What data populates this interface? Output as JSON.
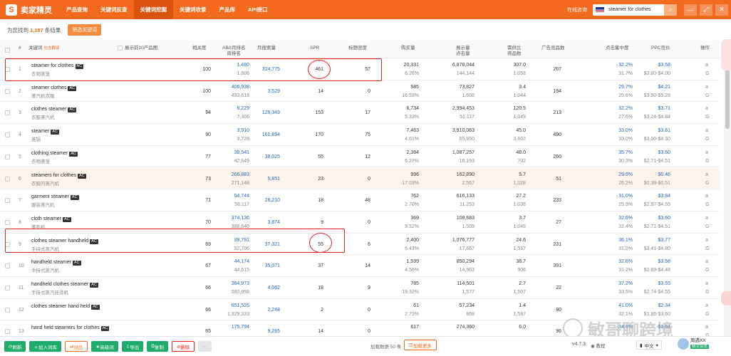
{
  "app": {
    "name": "卖家精灵",
    "logo_char": "S"
  },
  "nav": [
    "产品查询",
    "关键词反查",
    "关键词挖掘",
    "关键词收录",
    "产品库",
    "API接口"
  ],
  "nav_active": 2,
  "top": {
    "online": "在线咨询",
    "search_value": "steamer for clothes",
    "search_icon": "search-icon",
    "min": "—",
    "max": "⤢",
    "close": "✕"
  },
  "summary": {
    "prefix": "为您找到",
    "count": "1,187",
    "suffix": "条结果",
    "filter_btn": "筛选关键词"
  },
  "headers": {
    "keyword": "关键词",
    "keyword_sub": "包含翻译",
    "show_top10": "展示前10产品图",
    "relevance": "相关度",
    "aba_line1": "ABA月排名",
    "aba_line2": "周排名",
    "monthly_search": "月搜索量",
    "spr": "SPR",
    "title_density": "标题密度",
    "purchases": "购买量",
    "imp_line1": "展示量",
    "imp_line2": "点击量",
    "supply_line1": "需供比",
    "supply_line2": "商品数",
    "ad_count": "广告竞品数",
    "click_conc": "点击集中度",
    "ppc": "PPC竞价",
    "ops": "操作"
  },
  "rows": [
    {
      "idx": "1",
      "kw": "steamer for clothes",
      "cn": "衣物蒸笼",
      "rel": "100",
      "aba": "1,480",
      "aba_w": "1,806",
      "ms": "324,775",
      "spr": "461",
      "td": "57",
      "buy": "20,331",
      "buy_p": "6.26%",
      "imp": "6,878,044",
      "clk": "144,144",
      "sr": "307.0",
      "goods": "1,058",
      "ad": "267",
      "cc": "32.2%",
      "cc2": "31.7%",
      "ppc": "$3.58",
      "ppc_r": "$3.00-$4.00"
    },
    {
      "idx": "2",
      "kw": "steamer clothes",
      "cn": "蒸汽机衣服",
      "rel": "100",
      "aba": "406,938",
      "aba_w": "493,618",
      "ms": "3,529",
      "spr": "14",
      "td": "0",
      "buy": "585",
      "buy_p": "16.59%",
      "imp": "73,827",
      "clk": "1,666",
      "sr": "3.4",
      "goods": "1,044",
      "ad": "194",
      "cc": "29.7%",
      "cc2": "25.6%",
      "ppc": "$4.21",
      "ppc_r": "$3.50-$5.28"
    },
    {
      "idx": "3",
      "kw": "clothes steamer",
      "cn": "衣服蒸汽机",
      "rel": "94",
      "aba": "6,229",
      "aba_w": "7,306",
      "ms": "126,349",
      "spr": "153",
      "td": "17",
      "buy": "6,734",
      "buy_p": "5.33%",
      "imp": "2,994,453",
      "clk": "51,117",
      "sr": "120.5",
      "goods": "1,049",
      "ad": "213",
      "cc": "32.2%",
      "cc2": "27.6%",
      "ppc": "$3.71",
      "ppc_r": "$3.24-$4.84"
    },
    {
      "idx": "4",
      "kw": "steamer",
      "cn": "蒸锅",
      "rel": "90",
      "aba": "3,910",
      "aba_w": "3,728",
      "ms": "161,894",
      "spr": "170",
      "td": "75",
      "buy": "7,463",
      "buy_p": "4.61%",
      "imp": "3,910,063",
      "clk": "65,950",
      "sr": "45.0",
      "goods": "3,602",
      "ad": "490",
      "cc": "33.0%",
      "cc2": "33.0%",
      "ppc": "$3.61",
      "ppc_r": "$3.00-$4.30"
    },
    {
      "idx": "5",
      "kw": "clothing steamer",
      "cn": "衣物蒸笼",
      "rel": "77",
      "aba": "38,541",
      "aba_w": "42,649",
      "ms": "38,025",
      "spr": "55",
      "td": "12",
      "buy": "2,384",
      "buy_p": "6.27%",
      "imp": "1,087,257",
      "clk": "16,193",
      "sr": "48.0",
      "goods": "792",
      "ad": "260",
      "cc": "35.7%",
      "cc2": "30.3%",
      "ppc": "$3.60",
      "ppc_r": "$2.71-$4.51"
    },
    {
      "idx": "6",
      "kw": "steamers for clothes",
      "cn": "衣服的蒸汽机",
      "rel": "73",
      "aba": "266,883",
      "aba_w": "271,148",
      "ms": "5,851",
      "spr": "23",
      "td": "0",
      "buy": "996",
      "buy_p": "17.03%",
      "imp": "162,890",
      "clk": "2,567",
      "sr": "5.7",
      "goods": "1,028",
      "ad": "51",
      "cc": "29.6%",
      "cc2": "26.2%",
      "ppc": "$0.46",
      "ppc_r": "$0.38-$0.51"
    },
    {
      "idx": "7",
      "kw": "garment steamer",
      "cn": "服装蒸汽机",
      "rel": "71",
      "aba": "54,744",
      "aba_w": "58,117",
      "ms": "28,210",
      "spr": "18",
      "td": "48",
      "buy": "762",
      "buy_p": "2.70%",
      "imp": "616,133",
      "clk": "11,253",
      "sr": "27.2",
      "goods": "1,036",
      "ad": "233",
      "cc": "31.0%",
      "cc2": "25.9%",
      "ppc": "$3.84",
      "ppc_r": "$2.97-$4.55"
    },
    {
      "idx": "8",
      "kw": "cloth steamer",
      "cn": "蒸布机",
      "rel": "70",
      "aba": "374,136",
      "aba_w": "388,640",
      "ms": "3,874",
      "spr": "9",
      "td": "0",
      "buy": "369",
      "buy_p": "9.52%",
      "imp": "108,683",
      "clk": "1,509",
      "sr": "3.7",
      "goods": "1,045",
      "ad": "27",
      "cc": "32.6%",
      "cc2": "32.4%",
      "ppc": "$3.60",
      "ppc_r": "$2.71-$4.51"
    },
    {
      "idx": "9",
      "kw": "clothes steamer handheld",
      "cn": "手持式蒸汽机",
      "rel": "69",
      "aba": "39,791",
      "aba_w": "52,706",
      "ms": "37,321",
      "spr": "55",
      "td": "6",
      "buy": "2,400",
      "buy_p": "6.43%",
      "imp": "1,076,777",
      "clk": "17,667",
      "sr": "24.6",
      "goods": "1,517",
      "ad": "231",
      "cc": "36.1%",
      "cc2": "31.0%",
      "ppc": "$3.77",
      "ppc_r": "$3.41-$4.80"
    },
    {
      "idx": "10",
      "kw": "handheld steamer",
      "cn": "手持式蒸汽机",
      "rel": "67",
      "aba": "44,174",
      "aba_w": "44,615",
      "ms": "35,071",
      "spr": "37",
      "td": "14",
      "buy": "1,599",
      "buy_p": "4.56%",
      "imp": "850,294",
      "clk": "14,963",
      "sr": "38.7",
      "goods": "906",
      "ad": "391",
      "cc": "32.6%",
      "cc2": "31.2%",
      "ppc": "$3.58",
      "ppc_r": "$2.69-$4.48"
    },
    {
      "idx": "11",
      "kw": "handheld clothes steamer",
      "cn": "手持式蒸汽挂烫机",
      "rel": "66",
      "aba": "364,973",
      "aba_w": "562,958",
      "ms": "4,062",
      "spr": "18",
      "td": "9",
      "buy": "785",
      "buy_p": "19.32%",
      "imp": "114,501",
      "clk": "1,577",
      "sr": "2.7",
      "goods": "1,507",
      "ad": "22",
      "cc": "37.2%",
      "cc2": "33.5%",
      "ppc": "$3.55",
      "ppc_r": "$2.74-$4.55"
    },
    {
      "idx": "12",
      "kw": "clothes steamer hand held",
      "cn": "",
      "rel": "66",
      "aba": "651,526",
      "aba_w": "1,329,333",
      "ms": "2,248",
      "spr": "2",
      "td": "0",
      "buy": "61",
      "buy_p": "2.73%",
      "imp": "57,234",
      "clk": "868",
      "sr": "1.4",
      "goods": "1,587",
      "ad": "80",
      "cc": "41.0%",
      "cc2": "32.1%",
      "ppc": "$2.34",
      "ppc_r": "$1.86-$3.60"
    },
    {
      "idx": "13",
      "kw": "hand held steamers for clothes",
      "cn": "",
      "rel": "65",
      "aba": "175,794",
      "aba_w": "",
      "ms": "9,265",
      "spr": "14",
      "td": "0",
      "buy": "617",
      "buy_p": "",
      "imp": "274,360",
      "clk": "",
      "sr": "6.0",
      "goods": "",
      "ad": "96",
      "cc": "34.9%",
      "cc2": "",
      "ppc": "$3.84",
      "ppc_r": ""
    }
  ],
  "row_ops": {
    "op1": "a",
    "op2": "G"
  },
  "bottom": {
    "refresh": "刷新",
    "add_lib": "加入词库",
    "compare": "对比",
    "advanced": "高级词",
    "export": "导出",
    "copy": "复制",
    "delete": "删除",
    "more": "⋯",
    "loaded": "加载数据 50 条",
    "load_more": "加载更多",
    "version": "v4.7.3",
    "tutorial": "教程",
    "lang": "中文",
    "user": "周遇XX",
    "vip": "精灵会员"
  },
  "watermark": "敏哥聊跨境"
}
